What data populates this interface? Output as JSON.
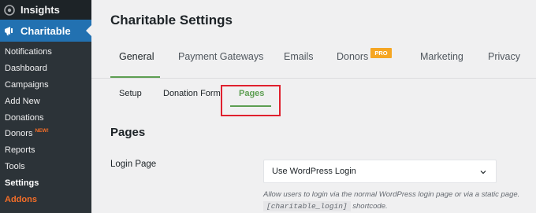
{
  "sidebar": {
    "top_item": {
      "label": "Insights",
      "icon": "insights-icon"
    },
    "active_item": {
      "label": "Charitable",
      "icon": "charitable-megaphone-icon"
    },
    "submenu": [
      {
        "label": "Notifications"
      },
      {
        "label": "Dashboard"
      },
      {
        "label": "Campaigns"
      },
      {
        "label": "Add New"
      },
      {
        "label": "Donations"
      },
      {
        "label": "Donors",
        "badge": "NEW!"
      },
      {
        "label": "Reports"
      },
      {
        "label": "Tools"
      },
      {
        "label": "Settings"
      },
      {
        "label": "Addons"
      }
    ]
  },
  "page": {
    "title": "Charitable Settings"
  },
  "tabs": [
    {
      "label": "General"
    },
    {
      "label": "Payment Gateways"
    },
    {
      "label": "Emails"
    },
    {
      "label": "Donors",
      "badge": "PRO"
    },
    {
      "label": "Marketing"
    },
    {
      "label": "Privacy"
    }
  ],
  "subtabs": [
    {
      "label": "Setup"
    },
    {
      "label": "Donation Form"
    },
    {
      "label": "Pages"
    }
  ],
  "section": {
    "title": "Pages",
    "login_page": {
      "label": "Login Page",
      "selected": "Use WordPress Login",
      "help_text": "Allow users to login via the normal WordPress login page or via a static page.",
      "shortcode": "[charitable_login]",
      "help_suffix": "shortcode."
    }
  },
  "colors": {
    "sidebar_bg": "#1d2327",
    "submenu_bg": "#2c3338",
    "active_blue": "#2271b1",
    "accent_green": "#5d9e52",
    "badge_orange": "#f5a623",
    "new_orange": "#f56e28",
    "highlight_red": "#e0202e"
  }
}
